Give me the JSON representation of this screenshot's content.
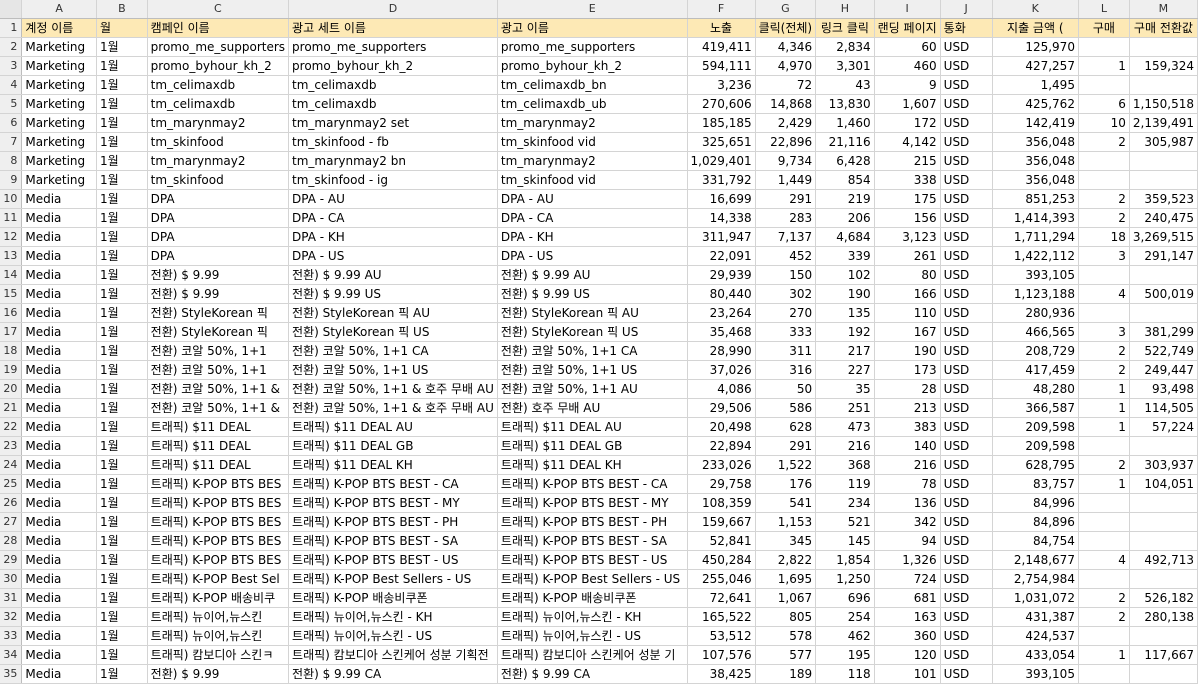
{
  "columns": [
    "A",
    "B",
    "C",
    "D",
    "E",
    "F",
    "G",
    "H",
    "I",
    "J",
    "K",
    "L",
    "M"
  ],
  "header_row": {
    "num": "1",
    "cells": [
      "계정 이름",
      "월",
      "캠페인 이름",
      "광고 세트 이름",
      "광고 이름",
      "노출",
      "클릭(전체)",
      "링크 클릭",
      "랜딩 페이지",
      "통화",
      "지출 금액 (",
      "구매",
      "구매 전환값"
    ]
  },
  "rows": [
    {
      "num": "2",
      "cells": [
        "Marketing",
        "1월",
        "promo_me_supporters",
        "promo_me_supporters",
        "promo_me_supporters",
        "419,411",
        "4,346",
        "2,834",
        "60",
        "USD",
        "125,970",
        "",
        ""
      ]
    },
    {
      "num": "3",
      "cells": [
        "Marketing",
        "1월",
        "promo_byhour_kh_2",
        "promo_byhour_kh_2",
        "promo_byhour_kh_2",
        "594,111",
        "4,970",
        "3,301",
        "460",
        "USD",
        "427,257",
        "1",
        "159,324"
      ]
    },
    {
      "num": "4",
      "cells": [
        "Marketing",
        "1월",
        "tm_celimaxdb",
        "tm_celimaxdb",
        "tm_celimaxdb_bn",
        "3,236",
        "72",
        "43",
        "9",
        "USD",
        "1,495",
        "",
        ""
      ]
    },
    {
      "num": "5",
      "cells": [
        "Marketing",
        "1월",
        "tm_celimaxdb",
        "tm_celimaxdb",
        "tm_celimaxdb_ub",
        "270,606",
        "14,868",
        "13,830",
        "1,607",
        "USD",
        "425,762",
        "6",
        "1,150,518"
      ]
    },
    {
      "num": "6",
      "cells": [
        "Marketing",
        "1월",
        "tm_marynmay2",
        "tm_marynmay2 set",
        "tm_marynmay2",
        "185,185",
        "2,429",
        "1,460",
        "172",
        "USD",
        "142,419",
        "10",
        "2,139,491"
      ]
    },
    {
      "num": "7",
      "cells": [
        "Marketing",
        "1월",
        "tm_skinfood",
        "tm_skinfood - fb",
        "tm_skinfood vid",
        "325,651",
        "22,896",
        "21,116",
        "4,142",
        "USD",
        "356,048",
        "2",
        "305,987"
      ]
    },
    {
      "num": "8",
      "cells": [
        "Marketing",
        "1월",
        "tm_marynmay2",
        "tm_marynmay2 bn",
        "tm_marynmay2",
        "1,029,401",
        "9,734",
        "6,428",
        "215",
        "USD",
        "356,048",
        "",
        ""
      ]
    },
    {
      "num": "9",
      "cells": [
        "Marketing",
        "1월",
        "tm_skinfood",
        "tm_skinfood - ig",
        "tm_skinfood vid",
        "331,792",
        "1,449",
        "854",
        "338",
        "USD",
        "356,048",
        "",
        ""
      ]
    },
    {
      "num": "10",
      "cells": [
        "Media",
        "1월",
        "DPA",
        "DPA - AU",
        "DPA - AU",
        "16,699",
        "291",
        "219",
        "175",
        "USD",
        "851,253",
        "2",
        "359,523"
      ]
    },
    {
      "num": "11",
      "cells": [
        "Media",
        "1월",
        "DPA",
        "DPA - CA",
        "DPA - CA",
        "14,338",
        "283",
        "206",
        "156",
        "USD",
        "1,414,393",
        "2",
        "240,475"
      ]
    },
    {
      "num": "12",
      "cells": [
        "Media",
        "1월",
        "DPA",
        "DPA - KH",
        "DPA - KH",
        "311,947",
        "7,137",
        "4,684",
        "3,123",
        "USD",
        "1,711,294",
        "18",
        "3,269,515"
      ]
    },
    {
      "num": "13",
      "cells": [
        "Media",
        "1월",
        "DPA",
        "DPA - US",
        "DPA - US",
        "22,091",
        "452",
        "339",
        "261",
        "USD",
        "1,422,112",
        "3",
        "291,147"
      ]
    },
    {
      "num": "14",
      "cells": [
        "Media",
        "1월",
        "전환) $ 9.99",
        "전환) $ 9.99 AU",
        "전환) $ 9.99 AU",
        "29,939",
        "150",
        "102",
        "80",
        "USD",
        "393,105",
        "",
        ""
      ]
    },
    {
      "num": "15",
      "cells": [
        "Media",
        "1월",
        "전환) $ 9.99",
        "전환) $ 9.99 US",
        "전환) $ 9.99 US",
        "80,440",
        "302",
        "190",
        "166",
        "USD",
        "1,123,188",
        "4",
        "500,019"
      ]
    },
    {
      "num": "16",
      "cells": [
        "Media",
        "1월",
        "전환) StyleKorean 픽",
        "전환) StyleKorean 픽 AU",
        "전환) StyleKorean 픽 AU",
        "23,264",
        "270",
        "135",
        "110",
        "USD",
        "280,936",
        "",
        ""
      ]
    },
    {
      "num": "17",
      "cells": [
        "Media",
        "1월",
        "전환) StyleKorean 픽",
        "전환) StyleKorean 픽 US",
        "전환) StyleKorean 픽 US",
        "35,468",
        "333",
        "192",
        "167",
        "USD",
        "466,565",
        "3",
        "381,299"
      ]
    },
    {
      "num": "18",
      "cells": [
        "Media",
        "1월",
        "전환) 코알 50%, 1+1",
        "전환) 코알 50%, 1+1 CA",
        "전환) 코알 50%, 1+1 CA",
        "28,990",
        "311",
        "217",
        "190",
        "USD",
        "208,729",
        "2",
        "522,749"
      ]
    },
    {
      "num": "19",
      "cells": [
        "Media",
        "1월",
        "전환) 코알 50%, 1+1",
        "전환) 코알 50%, 1+1 US",
        "전환) 코알 50%, 1+1 US",
        "37,026",
        "316",
        "227",
        "173",
        "USD",
        "417,459",
        "2",
        "249,447"
      ]
    },
    {
      "num": "20",
      "cells": [
        "Media",
        "1월",
        "전환) 코알 50%, 1+1 &",
        "전환) 코알 50%, 1+1 & 호주 무배 AU",
        "전환) 코알 50%, 1+1 AU",
        "4,086",
        "50",
        "35",
        "28",
        "USD",
        "48,280",
        "1",
        "93,498"
      ]
    },
    {
      "num": "21",
      "cells": [
        "Media",
        "1월",
        "전환) 코알 50%, 1+1 &",
        "전환) 코알 50%, 1+1 & 호주 무배 AU",
        "전환) 호주 무배 AU",
        "29,506",
        "586",
        "251",
        "213",
        "USD",
        "366,587",
        "1",
        "114,505"
      ]
    },
    {
      "num": "22",
      "cells": [
        "Media",
        "1월",
        "트래픽) $11 DEAL",
        "트래픽) $11 DEAL AU",
        "트래픽) $11 DEAL AU",
        "20,498",
        "628",
        "473",
        "383",
        "USD",
        "209,598",
        "1",
        "57,224"
      ]
    },
    {
      "num": "23",
      "cells": [
        "Media",
        "1월",
        "트래픽) $11 DEAL",
        "트래픽) $11 DEAL GB",
        "트래픽) $11 DEAL GB",
        "22,894",
        "291",
        "216",
        "140",
        "USD",
        "209,598",
        "",
        ""
      ]
    },
    {
      "num": "24",
      "cells": [
        "Media",
        "1월",
        "트래픽) $11 DEAL",
        "트래픽) $11 DEAL KH",
        "트래픽) $11 DEAL KH",
        "233,026",
        "1,522",
        "368",
        "216",
        "USD",
        "628,795",
        "2",
        "303,937"
      ]
    },
    {
      "num": "25",
      "cells": [
        "Media",
        "1월",
        "트래픽) K-POP BTS BES",
        "트래픽) K-POP BTS BEST - CA",
        "트래픽) K-POP BTS BEST - CA",
        "29,758",
        "176",
        "119",
        "78",
        "USD",
        "83,757",
        "1",
        "104,051"
      ]
    },
    {
      "num": "26",
      "cells": [
        "Media",
        "1월",
        "트래픽) K-POP BTS BES",
        "트래픽) K-POP BTS BEST - MY",
        "트래픽) K-POP BTS BEST - MY",
        "108,359",
        "541",
        "234",
        "136",
        "USD",
        "84,996",
        "",
        ""
      ]
    },
    {
      "num": "27",
      "cells": [
        "Media",
        "1월",
        "트래픽) K-POP BTS BES",
        "트래픽) K-POP BTS BEST - PH",
        "트래픽) K-POP BTS BEST - PH",
        "159,667",
        "1,153",
        "521",
        "342",
        "USD",
        "84,896",
        "",
        ""
      ]
    },
    {
      "num": "28",
      "cells": [
        "Media",
        "1월",
        "트래픽) K-POP BTS BES",
        "트래픽) K-POP BTS BEST - SA",
        "트래픽) K-POP BTS BEST - SA",
        "52,841",
        "345",
        "145",
        "94",
        "USD",
        "84,754",
        "",
        ""
      ]
    },
    {
      "num": "29",
      "cells": [
        "Media",
        "1월",
        "트래픽) K-POP BTS BES",
        "트래픽) K-POP BTS BEST - US",
        "트래픽) K-POP BTS BEST - US",
        "450,284",
        "2,822",
        "1,854",
        "1,326",
        "USD",
        "2,148,677",
        "4",
        "492,713"
      ]
    },
    {
      "num": "30",
      "cells": [
        "Media",
        "1월",
        "트래픽) K-POP Best Sel",
        "트래픽) K-POP Best Sellers - US",
        "트래픽) K-POP Best Sellers - US",
        "255,046",
        "1,695",
        "1,250",
        "724",
        "USD",
        "2,754,984",
        "",
        ""
      ]
    },
    {
      "num": "31",
      "cells": [
        "Media",
        "1월",
        "트래픽) K-POP 배송비쿠",
        "트래픽) K-POP 배송비쿠폰",
        "트래픽) K-POP 배송비쿠폰",
        "72,641",
        "1,067",
        "696",
        "681",
        "USD",
        "1,031,072",
        "2",
        "526,182"
      ]
    },
    {
      "num": "32",
      "cells": [
        "Media",
        "1월",
        "트래픽) 뉴이어,뉴스킨",
        "트래픽) 뉴이어,뉴스킨 - KH",
        "트래픽) 뉴이어,뉴스킨 - KH",
        "165,522",
        "805",
        "254",
        "163",
        "USD",
        "431,387",
        "2",
        "280,138"
      ]
    },
    {
      "num": "33",
      "cells": [
        "Media",
        "1월",
        "트래픽) 뉴이어,뉴스킨",
        "트래픽) 뉴이어,뉴스킨 - US",
        "트래픽) 뉴이어,뉴스킨 - US",
        "53,512",
        "578",
        "462",
        "360",
        "USD",
        "424,537",
        "",
        ""
      ]
    },
    {
      "num": "34",
      "cells": [
        "Media",
        "1월",
        "트래픽) 캄보디아 스킨ㅋ",
        "트래픽) 캄보디아 스킨케어 성분 기획전",
        "트래픽) 캄보디아 스킨케어 성분 기",
        "107,576",
        "577",
        "195",
        "120",
        "USD",
        "433,054",
        "1",
        "117,667"
      ]
    },
    {
      "num": "35",
      "cells": [
        "Media",
        "1월",
        "전환) $ 9.99",
        "전환) $ 9.99 CA",
        "전환) $ 9.99 CA",
        "38,425",
        "189",
        "118",
        "101",
        "USD",
        "393,105",
        "",
        ""
      ]
    }
  ]
}
